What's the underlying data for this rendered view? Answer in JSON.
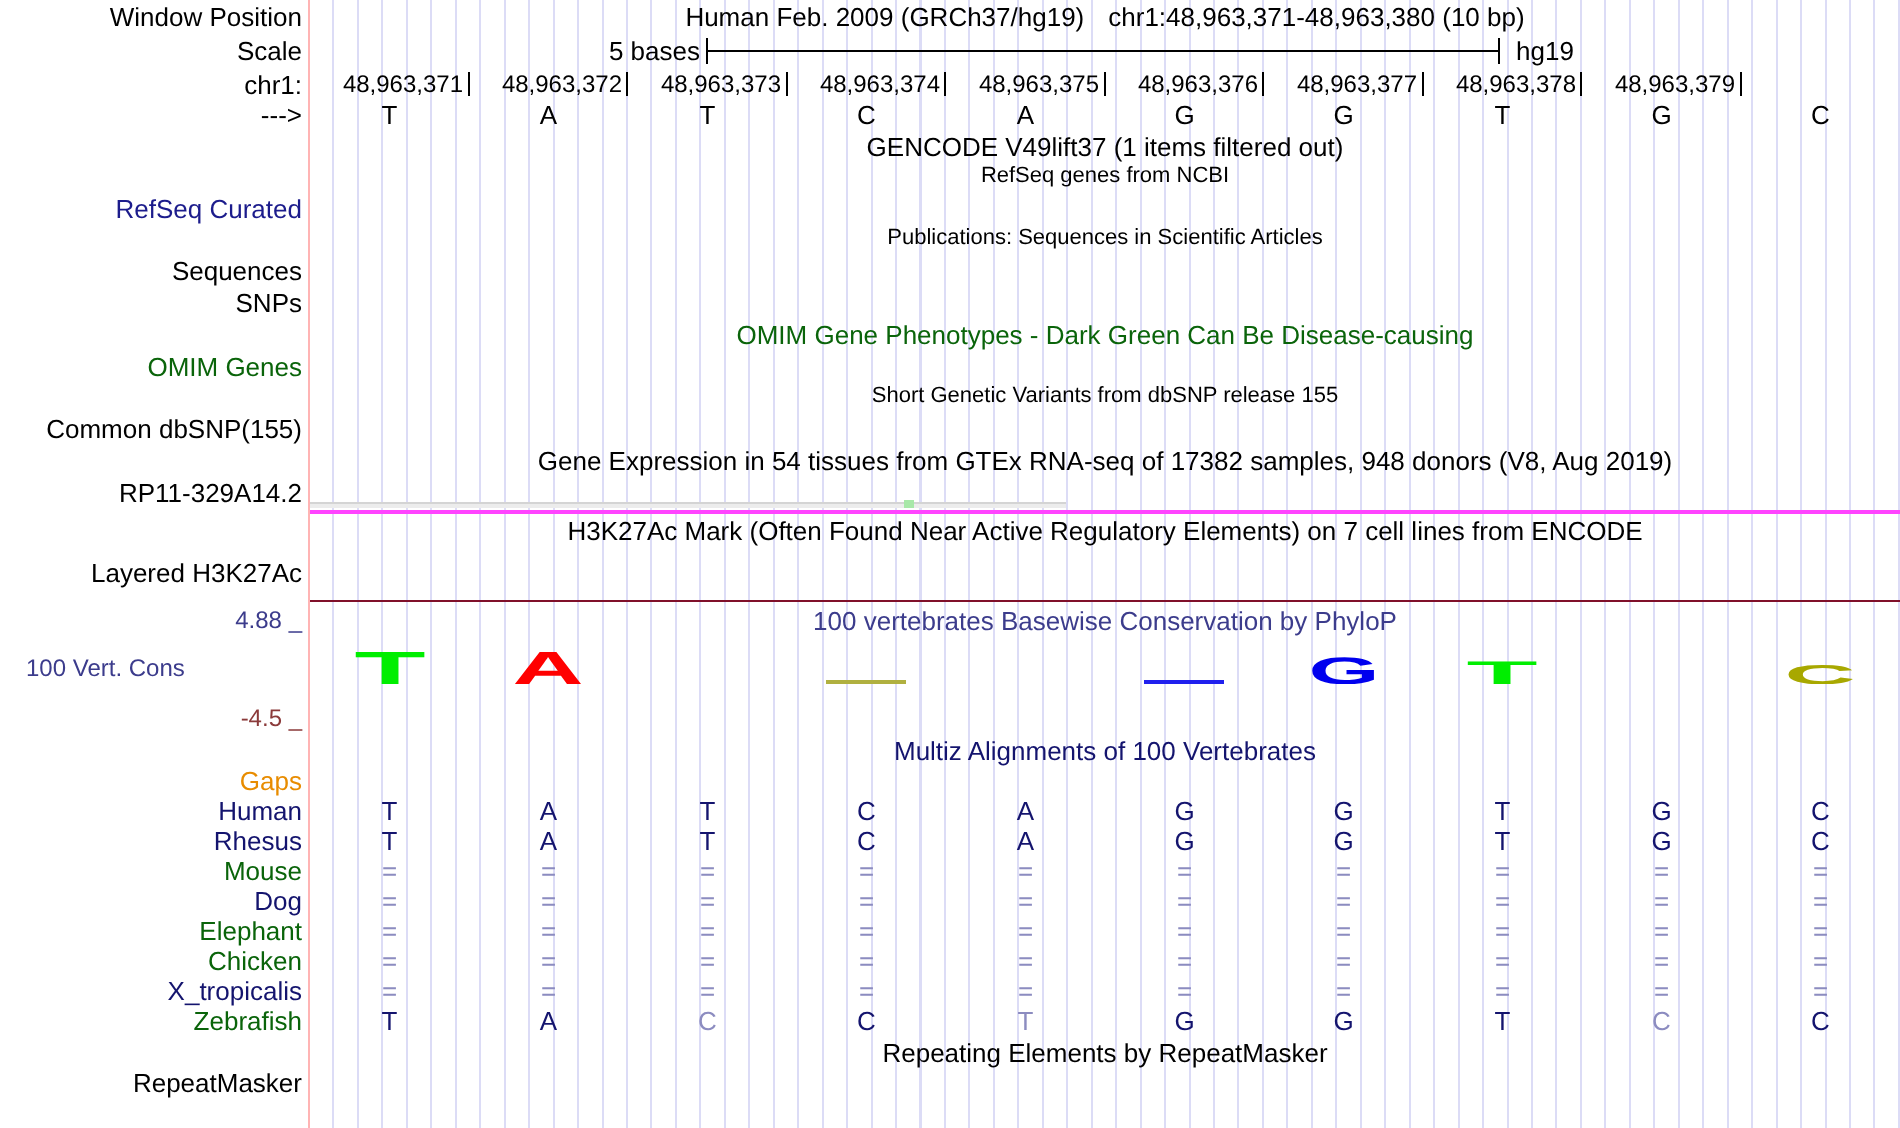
{
  "header": {
    "label": "Window Position",
    "title": "Human Feb. 2009 (GRCh37/hg19)",
    "position": "chr1:48,963,371-48,963,380 (10 bp)"
  },
  "scale": {
    "label": "Scale",
    "span": "5 bases",
    "assembly": "hg19"
  },
  "ruler": {
    "label": "chr1:",
    "positions": [
      "48,963,371",
      "48,963,372",
      "48,963,373",
      "48,963,374",
      "48,963,375",
      "48,963,376",
      "48,963,377",
      "48,963,378",
      "48,963,379"
    ]
  },
  "sequence": {
    "label": "--->",
    "bases": [
      "T",
      "A",
      "T",
      "C",
      "A",
      "G",
      "G",
      "T",
      "G",
      "C"
    ]
  },
  "tracks": [
    {
      "kind": "title",
      "text": "GENCODE V49lift37 (1 items filtered out)",
      "color": "#000000"
    },
    {
      "kind": "subtitle",
      "text": "RefSeq genes from NCBI",
      "color": "#000000"
    },
    {
      "kind": "label",
      "text": "RefSeq Curated",
      "color": "#1c1c8c"
    },
    {
      "kind": "subtitle",
      "text": "Publications: Sequences in Scientific Articles",
      "color": "#000000"
    },
    {
      "kind": "label",
      "text": "Sequences",
      "color": "#000000"
    },
    {
      "kind": "label",
      "text": "SNPs",
      "color": "#000000"
    },
    {
      "kind": "title",
      "text": "OMIM Gene Phenotypes - Dark Green Can Be Disease-causing",
      "color": "#0a640a"
    },
    {
      "kind": "label",
      "text": "OMIM Genes",
      "color": "#0a640a"
    },
    {
      "kind": "subtitle",
      "text": "Short Genetic Variants from dbSNP release 155",
      "color": "#000000"
    },
    {
      "kind": "label",
      "text": "Common dbSNP(155)",
      "color": "#000000"
    },
    {
      "kind": "title",
      "text": "Gene Expression in 54 tissues from GTEx RNA-seq of 17382 samples, 948 donors (V8, Aug 2019)",
      "color": "#000000"
    },
    {
      "kind": "expression",
      "text": "RP11-329A14.2",
      "color": "#000000"
    },
    {
      "kind": "title",
      "text": "H3K27Ac Mark (Often Found Near Active Regulatory Elements) on 7 cell lines from ENCODE",
      "color": "#000000"
    },
    {
      "kind": "layered",
      "text": "Layered H3K27Ac",
      "color": "#000000"
    }
  ],
  "conservation": {
    "title": "100 vertebrates Basewise Conservation by PhyloP",
    "label": "100 Vert. Cons",
    "max": "4.88 _",
    "min": "-4.5 _",
    "logo": [
      {
        "kind": "full",
        "base": "T",
        "color": "#00ee00"
      },
      {
        "kind": "full",
        "base": "A",
        "color": "#ff0000"
      },
      {
        "kind": "none"
      },
      {
        "kind": "flat",
        "color": "#b0b040"
      },
      {
        "kind": "none"
      },
      {
        "kind": "flat",
        "color": "#2020ee"
      },
      {
        "kind": "tall",
        "base": "G",
        "color": "#0000ee"
      },
      {
        "kind": "medium",
        "base": "T",
        "color": "#00ee00"
      },
      {
        "kind": "none"
      },
      {
        "kind": "short",
        "base": "C",
        "color": "#a8a800"
      }
    ]
  },
  "multiz": {
    "title": "Multiz Alignments of 100 Vertebrates",
    "gaps_label": "Gaps",
    "species": [
      {
        "name": "Human",
        "color": "#14146e",
        "bases": [
          {
            "text": "T",
            "faded": false
          },
          {
            "text": "A",
            "faded": false
          },
          {
            "text": "T",
            "faded": false
          },
          {
            "text": "C",
            "faded": false
          },
          {
            "text": "A",
            "faded": false
          },
          {
            "text": "G",
            "faded": false
          },
          {
            "text": "G",
            "faded": false
          },
          {
            "text": "T",
            "faded": false
          },
          {
            "text": "G",
            "faded": false
          },
          {
            "text": "C",
            "faded": false
          }
        ]
      },
      {
        "name": "Rhesus",
        "color": "#14146e",
        "bases": [
          {
            "text": "T",
            "faded": false
          },
          {
            "text": "A",
            "faded": false
          },
          {
            "text": "T",
            "faded": false
          },
          {
            "text": "C",
            "faded": false
          },
          {
            "text": "A",
            "faded": false
          },
          {
            "text": "G",
            "faded": false
          },
          {
            "text": "G",
            "faded": false
          },
          {
            "text": "T",
            "faded": false
          },
          {
            "text": "G",
            "faded": false
          },
          {
            "text": "C",
            "faded": false
          }
        ]
      },
      {
        "name": "Mouse",
        "color": "#0a640a",
        "bases": [
          {
            "text": "=",
            "faded": true
          },
          {
            "text": "=",
            "faded": true
          },
          {
            "text": "=",
            "faded": true
          },
          {
            "text": "=",
            "faded": true
          },
          {
            "text": "=",
            "faded": true
          },
          {
            "text": "=",
            "faded": true
          },
          {
            "text": "=",
            "faded": true
          },
          {
            "text": "=",
            "faded": true
          },
          {
            "text": "=",
            "faded": true
          },
          {
            "text": "=",
            "faded": true
          }
        ]
      },
      {
        "name": "Dog",
        "color": "#14146e",
        "bases": [
          {
            "text": "=",
            "faded": true
          },
          {
            "text": "=",
            "faded": true
          },
          {
            "text": "=",
            "faded": true
          },
          {
            "text": "=",
            "faded": true
          },
          {
            "text": "=",
            "faded": true
          },
          {
            "text": "=",
            "faded": true
          },
          {
            "text": "=",
            "faded": true
          },
          {
            "text": "=",
            "faded": true
          },
          {
            "text": "=",
            "faded": true
          },
          {
            "text": "=",
            "faded": true
          }
        ]
      },
      {
        "name": "Elephant",
        "color": "#0a640a",
        "bases": [
          {
            "text": "=",
            "faded": true
          },
          {
            "text": "=",
            "faded": true
          },
          {
            "text": "=",
            "faded": true
          },
          {
            "text": "=",
            "faded": true
          },
          {
            "text": "=",
            "faded": true
          },
          {
            "text": "=",
            "faded": true
          },
          {
            "text": "=",
            "faded": true
          },
          {
            "text": "=",
            "faded": true
          },
          {
            "text": "=",
            "faded": true
          },
          {
            "text": "=",
            "faded": true
          }
        ]
      },
      {
        "name": "Chicken",
        "color": "#0a640a",
        "bases": [
          {
            "text": "=",
            "faded": true
          },
          {
            "text": "=",
            "faded": true
          },
          {
            "text": "=",
            "faded": true
          },
          {
            "text": "=",
            "faded": true
          },
          {
            "text": "=",
            "faded": true
          },
          {
            "text": "=",
            "faded": true
          },
          {
            "text": "=",
            "faded": true
          },
          {
            "text": "=",
            "faded": true
          },
          {
            "text": "=",
            "faded": true
          },
          {
            "text": "=",
            "faded": true
          }
        ]
      },
      {
        "name": "X_tropicalis",
        "color": "#14146e",
        "bases": [
          {
            "text": "=",
            "faded": true
          },
          {
            "text": "=",
            "faded": true
          },
          {
            "text": "=",
            "faded": true
          },
          {
            "text": "=",
            "faded": true
          },
          {
            "text": "=",
            "faded": true
          },
          {
            "text": "=",
            "faded": true
          },
          {
            "text": "=",
            "faded": true
          },
          {
            "text": "=",
            "faded": true
          },
          {
            "text": "=",
            "faded": true
          },
          {
            "text": "=",
            "faded": true
          }
        ]
      },
      {
        "name": "Zebrafish",
        "color": "#0a640a",
        "bases": [
          {
            "text": "T",
            "faded": false
          },
          {
            "text": "A",
            "faded": false
          },
          {
            "text": "C",
            "faded": true
          },
          {
            "text": "C",
            "faded": false
          },
          {
            "text": "T",
            "faded": true
          },
          {
            "text": "G",
            "faded": false
          },
          {
            "text": "G",
            "faded": false
          },
          {
            "text": "T",
            "faded": false
          },
          {
            "text": "C",
            "faded": true
          },
          {
            "text": "C",
            "faded": false
          }
        ]
      }
    ]
  },
  "repeats": {
    "title": "Repeating Elements by RepeatMasker",
    "label": "RepeatMasker"
  }
}
